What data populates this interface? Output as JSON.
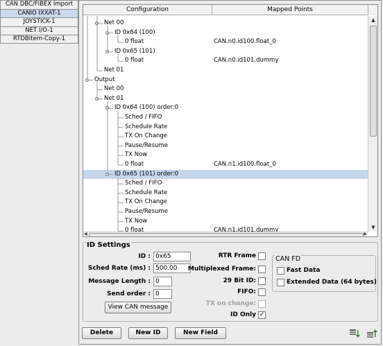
{
  "sidebar": {
    "tabs": [
      {
        "label": "CAN DBC/FIBEX Import",
        "active": false
      },
      {
        "label": "CANIO IXXAT-1",
        "active": true
      },
      {
        "label": "JOYSTICK-1",
        "active": false
      },
      {
        "label": "NET I/O-1",
        "active": false
      },
      {
        "label": "RTDBItem-Copy-1",
        "active": false
      }
    ]
  },
  "table": {
    "col_configuration": "Configuration",
    "col_mapped": "Mapped Points",
    "rows": [
      {
        "label": "Net 00",
        "mapped": "",
        "level": 2,
        "toggle": true,
        "selected": false
      },
      {
        "label": "ID 0x64 (100)",
        "mapped": "",
        "level": 3,
        "toggle": true,
        "selected": false
      },
      {
        "label": "0 float",
        "mapped": "CAN.n0.id100.float_0",
        "level": 4,
        "toggle": false,
        "selected": false
      },
      {
        "label": "ID 0x65 (101)",
        "mapped": "",
        "level": 3,
        "toggle": true,
        "selected": false
      },
      {
        "label": "0 float",
        "mapped": "CAN.n0.id101.dummy",
        "level": 4,
        "toggle": false,
        "selected": false
      },
      {
        "label": "Net 01",
        "mapped": "",
        "level": 2,
        "toggle": false,
        "selected": false
      },
      {
        "label": "Output",
        "mapped": "",
        "level": 1,
        "toggle": true,
        "selected": false
      },
      {
        "label": "Net 00",
        "mapped": "",
        "level": 2,
        "toggle": false,
        "selected": false
      },
      {
        "label": "Net 01",
        "mapped": "",
        "level": 2,
        "toggle": true,
        "selected": false
      },
      {
        "label": "ID 0x64 (100) order:0",
        "mapped": "",
        "level": 3,
        "toggle": true,
        "selected": false
      },
      {
        "label": "Sched / FIFO",
        "mapped": "",
        "level": 4,
        "toggle": false,
        "selected": false
      },
      {
        "label": "Schedule Rate",
        "mapped": "",
        "level": 4,
        "toggle": false,
        "selected": false
      },
      {
        "label": "TX On Change",
        "mapped": "",
        "level": 4,
        "toggle": false,
        "selected": false
      },
      {
        "label": "Pause/Resume",
        "mapped": "",
        "level": 4,
        "toggle": false,
        "selected": false
      },
      {
        "label": "TX Now",
        "mapped": "",
        "level": 4,
        "toggle": false,
        "selected": false
      },
      {
        "label": "0 float",
        "mapped": "CAN.n1.id100.float_0",
        "level": 4,
        "toggle": false,
        "selected": false
      },
      {
        "label": "ID 0x65 (101) order:0",
        "mapped": "",
        "level": 3,
        "toggle": true,
        "selected": true
      },
      {
        "label": "Sched / FIFO",
        "mapped": "",
        "level": 4,
        "toggle": false,
        "selected": false
      },
      {
        "label": "Schedule Rate",
        "mapped": "",
        "level": 4,
        "toggle": false,
        "selected": false
      },
      {
        "label": "TX On Change",
        "mapped": "",
        "level": 4,
        "toggle": false,
        "selected": false
      },
      {
        "label": "Pause/Resume",
        "mapped": "",
        "level": 4,
        "toggle": false,
        "selected": false
      },
      {
        "label": "TX Now",
        "mapped": "",
        "level": 4,
        "toggle": false,
        "selected": false
      },
      {
        "label": "0 float",
        "mapped": "CAN.n1.id101.dummy",
        "level": 4,
        "toggle": false,
        "selected": false
      }
    ]
  },
  "settings": {
    "title": "ID Settings",
    "id_label": "ID :",
    "id_value": "0x65",
    "sched_rate_label": "Sched Rate (ms) :",
    "sched_rate_value": "500.00",
    "msg_length_label": "Message Length :",
    "msg_length_value": "0",
    "send_order_label": "Send order :",
    "send_order_value": "0",
    "view_button": "View  CAN  message",
    "rtr_label": "RTR Frame",
    "rtr_checked": "",
    "multiplexed_label": "Multiplexed Frame:",
    "multiplexed_checked": "",
    "bit29_label": "29 Bit ID:",
    "bit29_checked": "",
    "fifo_label": "FIFO:",
    "fifo_checked": "",
    "tx_change_label": "TX on change:",
    "tx_change_checked": "",
    "id_only_label": "ID Only",
    "id_only_checked": "✓",
    "canfd_title": "CAN FD",
    "fast_data_label": "Fast Data",
    "fast_data_checked": "",
    "extended_label": "Extended Data (64 bytes)",
    "extended_checked": ""
  },
  "buttons": {
    "delete": "Delete",
    "new_id": "New ID",
    "new_field": "New Field"
  },
  "icons": {
    "import_icon": "import-down-arrow-icon",
    "export_icon": "export-up-arrow-icon",
    "accent": "#3a7bd5"
  }
}
